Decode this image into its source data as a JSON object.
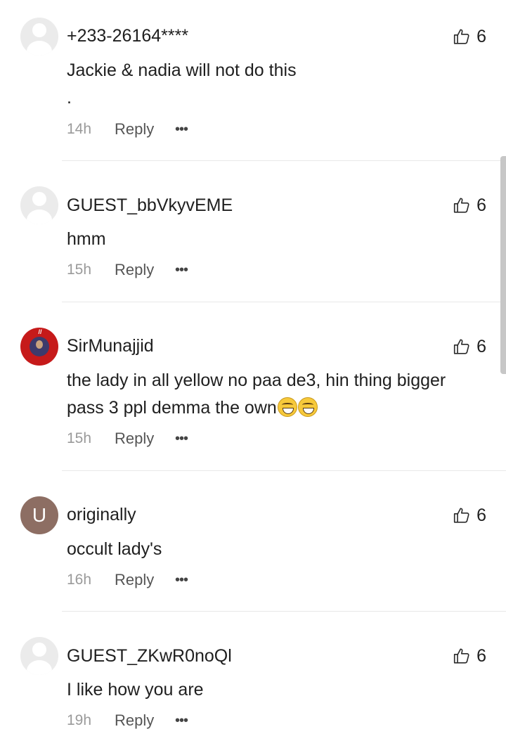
{
  "comments": [
    {
      "username": "+233-26164****",
      "avatar": "guest-avatar",
      "text": "Jackie & nadia will not do this\n.",
      "time": "14h",
      "likes": "6",
      "reply_label": "Reply",
      "more_label": "•••"
    },
    {
      "username": "GUEST_bbVkyvEME",
      "avatar": "guest-avatar",
      "text": "hmm",
      "time": "15h",
      "likes": "6",
      "reply_label": "Reply",
      "more_label": "•••"
    },
    {
      "username": "SirMunajjid",
      "avatar": "profile-photo",
      "text": "the lady in all yellow no paa de3, hin thing bigger pass 3 ppl demma the own",
      "emojis": [
        "laughing-emoji",
        "laughing-emoji"
      ],
      "time": "15h",
      "likes": "6",
      "reply_label": "Reply",
      "more_label": "•••"
    },
    {
      "username": "originally",
      "avatar": "letter-avatar",
      "avatar_letter": "U",
      "avatar_color": "#8d6e63",
      "text": "occult lady's",
      "time": "16h",
      "likes": "6",
      "reply_label": "Reply",
      "more_label": "•••"
    },
    {
      "username": "GUEST_ZKwR0noQl",
      "avatar": "guest-avatar",
      "text": "I like how you are",
      "time": "19h",
      "likes": "6",
      "reply_label": "Reply",
      "more_label": "•••"
    }
  ],
  "icons": {
    "like": "thumbs-up-icon",
    "more": "more-dots-icon"
  },
  "colors": {
    "text": "#1f1f1f",
    "muted": "#9a9a9a",
    "divider": "#e8e8e8",
    "avatar_guest": "#ebebeb",
    "avatar_letter": "#8d6e63",
    "avatar_photo": "#c61a1a"
  }
}
